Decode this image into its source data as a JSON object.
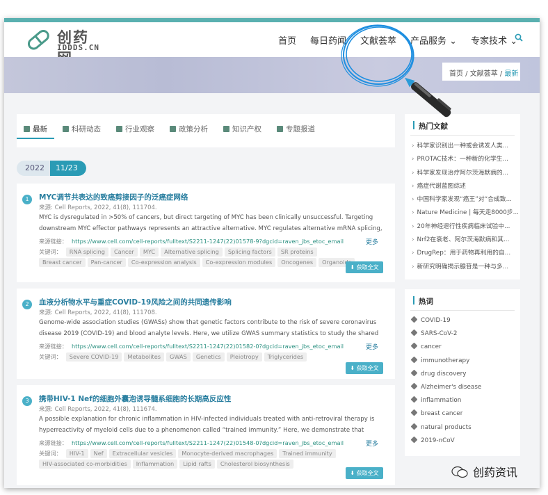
{
  "site": {
    "name_cn": "创药网",
    "name_en": "IDDDS.CN"
  },
  "nav": {
    "items": [
      "首页",
      "每日药闻",
      "文献荟萃",
      "产品服务 ⌄",
      "专家技术 ⌄"
    ],
    "search_icon": "search-icon"
  },
  "breadcrumb": {
    "home": "首页 /",
    "section": "文献荟萃 /",
    "current": "最新"
  },
  "tabs": [
    "最新",
    "科研动态",
    "行业观察",
    "政策分析",
    "知识产权",
    "专题报道"
  ],
  "date": {
    "year": "2022",
    "month_day": "11/23"
  },
  "labels": {
    "link_prefix": "来源链接：",
    "keywords_prefix": "关键词：",
    "more": "更多",
    "download": "⬇ 获取全文"
  },
  "articles": [
    {
      "num": "1",
      "title": "MYC调节共表达的致癌剪接因子的泛癌症网络",
      "source": "来源: Cell Reports, 2022, 41(8), 111704.",
      "abstract": "MYC is dysregulated in >50% of cancers, but direct targeting of MYC has been clinically unsuccessful. Targeting downstream MYC effector pathways represents an attractive alternative. MYC regulates alternative mRNA splicing, but the mechanis...",
      "link": "https://www.cell.com/cell-reports/fulltext/S2211-1247(22)01578-9?dgcid=raven_jbs_etoc_email",
      "keywords": [
        "RNA splicing",
        "Cancer",
        "MYC",
        "Alternative splicing",
        "Splicing factors",
        "SR proteins",
        "Breast cancer",
        "Pan-cancer",
        "Co-expression analysis",
        "Co-expression modules",
        "Oncogenes",
        "Organoids"
      ]
    },
    {
      "num": "2",
      "title": "血液分析物水平与重症COVID-19风险之间的共同遗传影响",
      "source": "来源: Cell Reports, 2022, 41(8), 111708.",
      "abstract": "Genome-wide association studies (GWASs) show that genetic factors contribute to the risk of severe coronavirus disease 2019 (COVID-19) and blood analyte levels. Here, we utilize GWAS summary statistics to study the shared genetic influenc...",
      "link": "https://www.cell.com/cell-reports/fulltext/S2211-1247(22)01582-0?dgcid=raven_jbs_etoc_email",
      "keywords": [
        "Severe COVID-19",
        "Metabolites",
        "GWAS",
        "Genetics",
        "Pleiotropy",
        "Triglycerides"
      ]
    },
    {
      "num": "3",
      "title": "携带HIV-1 Nef的细胞外囊泡诱导髓系细胞的长期高反应性",
      "source": "来源: Cell Reports, 2022, 41(8), 111674.",
      "abstract": "A possible explanation for chronic inflammation in HIV-infected individuals treated with anti-retroviral therapy is hyperreactivity of myeloid cells due to a phenomenon called “trained immunity.” Here, we demonstrate that human monocyte-deriv...",
      "link": "https://www.cell.com/cell-reports/fulltext/S2211-1247(22)01548-0?dgcid=raven_jbs_etoc_email",
      "keywords": [
        "HIV-1",
        "Nef",
        "Extracellular vesicles",
        "Monocyte-derived macrophages",
        "Trained immunity",
        "HIV-associated co-morbidities",
        "Inflammation",
        "Lipid rafts",
        "Cholesterol biosynthesis"
      ]
    }
  ],
  "hot_docs": {
    "title": "热门文献",
    "items": [
      "科学家识别出一种或会诱发人类...",
      "PROTAC技术：一种新的化学生...",
      "科学家发现治疗阿尔茨海默病的...",
      "癌症代谢蓝图综述",
      "中国科学家发现“癌王”对“合成致...",
      "Nature Medicine | 每天走8000步...",
      "20年神经退行性疾病临床试验中...",
      "Nrf2在衰老、阿尔茨海默病和其...",
      "DrugRep：用于药物再利用的自...",
      "新研究明确揭示腺苷是一种与多..."
    ]
  },
  "hot_tags": {
    "title": "热词",
    "items": [
      "COVID-19",
      "SARS-CoV-2",
      "cancer",
      "immunotherapy",
      "drug discovery",
      "Alzheimer's disease",
      "inflammation",
      "breast cancer",
      "natural products",
      "2019-nCoV"
    ]
  },
  "watermark": "创药资讯",
  "colors": {
    "accent": "#2a9bb5",
    "topbar": "#5ab0b0",
    "annotation": "#1e8fe0"
  }
}
